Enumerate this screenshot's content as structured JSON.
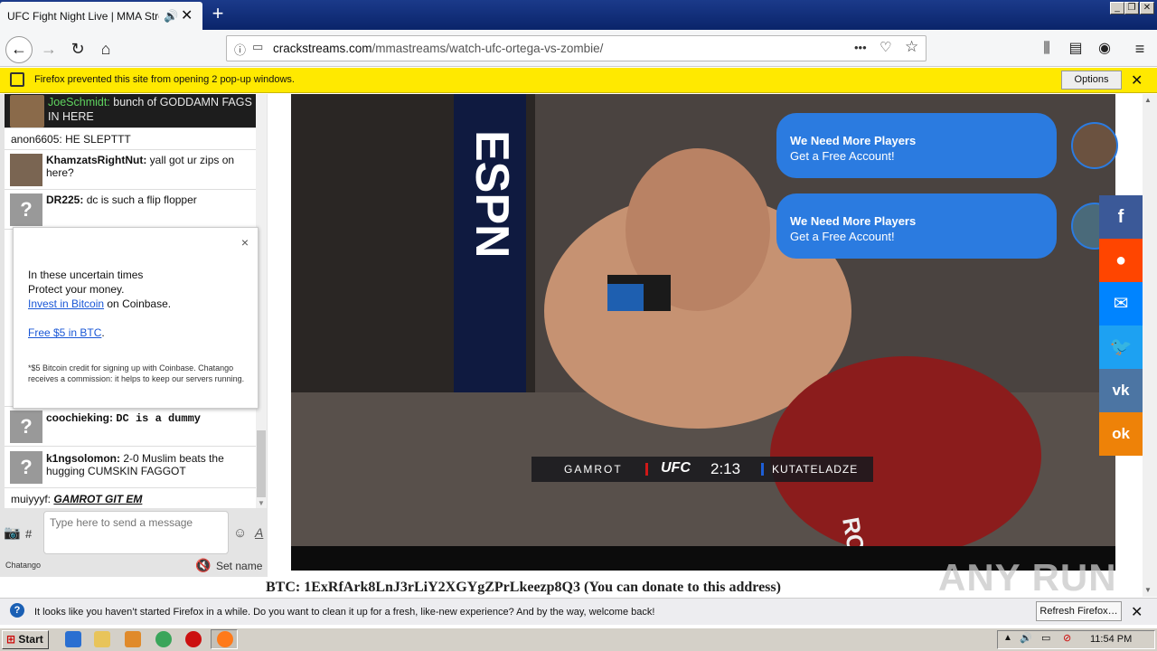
{
  "browser": {
    "tab_title": "UFC Fight Night Live | MMA Stream",
    "new_tab": "+",
    "url_host": "crackstreams.com",
    "url_path": "/mmastreams/watch-ufc-ortega-vs-zombie/",
    "url_more": "•••"
  },
  "popup_bar": {
    "message": "Firefox prevented this site from opening 2 pop-up windows.",
    "options_label": "Options"
  },
  "chat": {
    "messages": [
      {
        "user": "JoeSchmidt:",
        "text": "bunch of GODDAMN FAGS IN HERE"
      },
      {
        "user": "anon6605:",
        "text": "HE SLEPTTT"
      },
      {
        "user": "KhamzatsRightNut:",
        "text": "yall got ur zips on here?"
      },
      {
        "user": "DR225:",
        "text": "dc is such a flip flopper"
      },
      {
        "user": "coochieking:",
        "text": "DC is a dummy"
      },
      {
        "user": "k1ngsolomon:",
        "text": "2-0 Muslim beats the hugging CUMSKIN FAGGOT"
      },
      {
        "user": "muiyyyf:",
        "text": "GAMROT GIT EM"
      }
    ],
    "input_placeholder": "Type here to send a message",
    "hash": "#",
    "brand": "Chatango",
    "set_name": "Set name"
  },
  "ad": {
    "close": "×",
    "line1": "In these uncertain times",
    "line2": "Protect your money.",
    "link1": "Invest in Bitcoin",
    "line3_suffix": " on Coinbase.",
    "link2": "Free $5 in BTC",
    "link2_suffix": ".",
    "fine_print": "*$5 Bitcoin credit for signing up with Coinbase. Chatango receives a commission: it helps to keep our servers running."
  },
  "video": {
    "bubbles": [
      {
        "title": "We Need More Players",
        "sub": "Get a Free Account!"
      },
      {
        "title": "We Need More Players",
        "sub": "Get a Free Account!"
      }
    ],
    "scoreboard": {
      "left_fighter": "GAMROT",
      "logo": "UFC",
      "time": "2:13",
      "right_fighter": "KUTATELADZE"
    },
    "cage_text": "ESPN",
    "shorts_text": "ROT"
  },
  "share_buttons": [
    {
      "name": "facebook",
      "glyph": "f",
      "color": "#3b5998"
    },
    {
      "name": "reddit",
      "glyph": "●",
      "color": "#ff4500"
    },
    {
      "name": "messenger",
      "glyph": "✉",
      "color": "#0084ff"
    },
    {
      "name": "twitter",
      "glyph": "🐦",
      "color": "#1da1f2"
    },
    {
      "name": "vk",
      "glyph": "vk",
      "color": "#4c75a3"
    },
    {
      "name": "odnoklassniki",
      "glyph": "ok",
      "color": "#ee8208"
    }
  ],
  "btc_line": "BTC: 1ExRfArk8LnJ3rLiY2XGYgZPrLkeezp8Q3 (You can donate to this address)",
  "watermark": "ANY RUN",
  "notification": {
    "message": "It looks like you haven’t started Firefox in a while. Do you want to clean it up for a fresh, like-new experience? And by the way, welcome back!",
    "refresh_label": "Refresh Firefox…"
  },
  "taskbar": {
    "start_label": "Start",
    "clock": "11:54 PM"
  }
}
